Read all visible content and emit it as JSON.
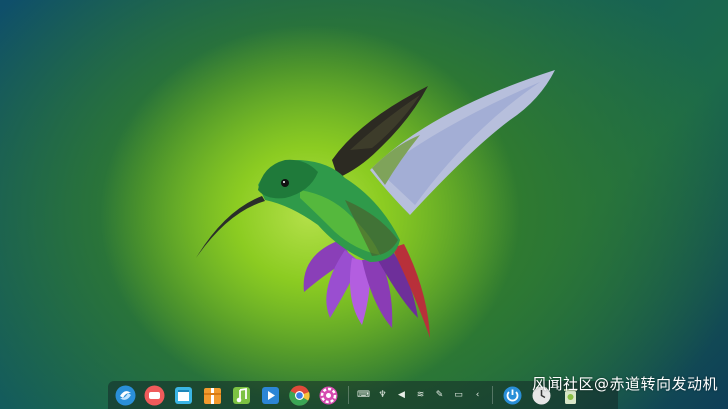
{
  "watermark": {
    "text": "风闻社区@赤道转向发动机"
  },
  "dock": {
    "apps": [
      {
        "icon": "launcher-icon",
        "color": "#2a8fd8"
      },
      {
        "icon": "screen-recorder-icon",
        "color": "#ef5b5b"
      },
      {
        "icon": "app-store-icon",
        "color": "#3bb5e5"
      },
      {
        "icon": "archive-manager-icon",
        "color": "#f29a2e"
      },
      {
        "icon": "music-player-icon",
        "color": "#7cc242"
      },
      {
        "icon": "video-player-icon",
        "color": "#2c86d6"
      },
      {
        "icon": "chrome-browser-icon",
        "color": "#e04a3a"
      },
      {
        "icon": "settings-icon",
        "color": "#d64bb0"
      }
    ],
    "tray": [
      "keyboard-icon",
      "usb-icon",
      "volume-icon",
      "wifi-icon",
      "pen-icon",
      "battery-icon",
      "notification-icon"
    ],
    "right_apps": [
      {
        "icon": "power-icon",
        "color": "#2a8fd8"
      },
      {
        "icon": "clock-icon",
        "color": "#e6e6e6"
      },
      {
        "icon": "trash-icon",
        "color": "#d8e6c8"
      }
    ]
  }
}
